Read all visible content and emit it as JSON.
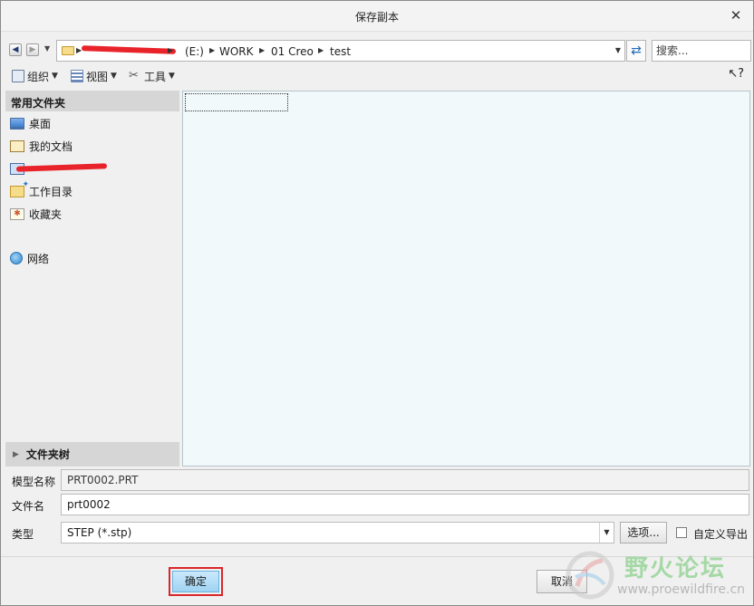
{
  "window": {
    "title": "保存副本",
    "close_icon": "close-icon"
  },
  "nav": {
    "back_icon": "back-arrow-icon",
    "forward_icon": "forward-arrow-icon",
    "history_icon": "chevron-down-icon",
    "breadcrumb": [
      "(E:)",
      "WORK",
      "01 Creo",
      "test"
    ],
    "refresh_icon": "refresh-icon",
    "search_placeholder": "搜索..."
  },
  "toolbar": {
    "organize": "组织",
    "view": "视图",
    "tools": "工具",
    "help_icon": "context-help-icon"
  },
  "sidebar": {
    "header": "常用文件夹",
    "items": [
      {
        "label": "桌面",
        "icon": "desktop-icon"
      },
      {
        "label": "我的文档",
        "icon": "documents-icon"
      },
      {
        "label": "",
        "icon": "computer-icon"
      },
      {
        "label": "工作目录",
        "icon": "working-directory-icon"
      },
      {
        "label": "收藏夹",
        "icon": "favorites-icon"
      },
      {
        "label": "网络",
        "icon": "network-icon"
      }
    ],
    "folder_tree": "文件夹树"
  },
  "form": {
    "model_name_label": "模型名称",
    "model_name_value": "PRT0002.PRT",
    "file_name_label": "文件名",
    "file_name_value": "prt0002",
    "type_label": "类型",
    "type_value": "STEP (*.stp)",
    "options_button": "选项...",
    "custom_export_label": "自定义导出",
    "custom_export_checked": false
  },
  "buttons": {
    "ok": "确定",
    "cancel": "取消"
  },
  "watermark": {
    "text": "野火论坛",
    "url": "www.proewildfire.cn"
  },
  "colors": {
    "highlight_border": "#d9262b",
    "ok_fill": "#9fd3f3",
    "file_pane_bg": "#f2f9fb"
  }
}
